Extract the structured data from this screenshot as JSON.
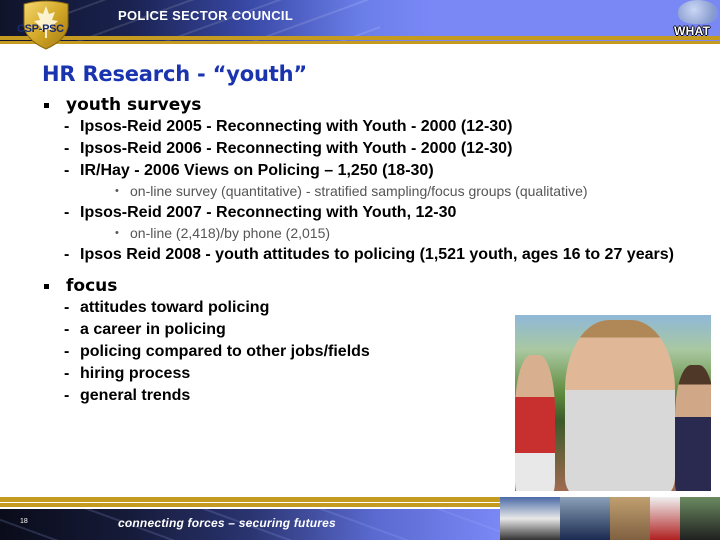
{
  "header": {
    "org_name": "POLICE SECTOR COUNCIL",
    "logo_text": "CSP-PSC",
    "corner_label": "WHAT"
  },
  "slide": {
    "title": "HR Research - “youth”",
    "sections": [
      {
        "heading": "youth surveys",
        "items": [
          {
            "text": "Ipsos-Reid 2005 - Reconnecting with Youth - 2000 (12-30)",
            "sub": []
          },
          {
            "text": "Ipsos-Reid 2006 - Reconnecting with Youth - 2000 (12-30)",
            "sub": []
          },
          {
            "text": "IR/Hay - 2006 Views on Policing – 1,250 (18-30)",
            "sub": [
              "on-line survey (quantitative) - stratified sampling/focus groups (qualitative)"
            ]
          },
          {
            "text": "Ipsos-Reid 2007 - Reconnecting with Youth, 12-30",
            "sub": [
              "on-line (2,418)/by phone (2,015)"
            ]
          },
          {
            "text": "Ipsos Reid 2008 - youth attitudes to policing  (1,521 youth, ages 16 to 27 years)",
            "sub": []
          }
        ]
      },
      {
        "heading": "focus",
        "items": [
          {
            "text": "attitudes toward policing",
            "sub": []
          },
          {
            "text": "a career in policing",
            "sub": []
          },
          {
            "text": "policing compared to other jobs/fields",
            "sub": []
          },
          {
            "text": "hiring process",
            "sub": []
          },
          {
            "text": "general trends",
            "sub": []
          }
        ]
      }
    ]
  },
  "footer": {
    "page_number": "18",
    "tagline": "connecting forces – securing futures"
  },
  "colors": {
    "title_blue": "#1a34b0",
    "gold": "#c49a20",
    "header_blue": "#7a88f6"
  }
}
